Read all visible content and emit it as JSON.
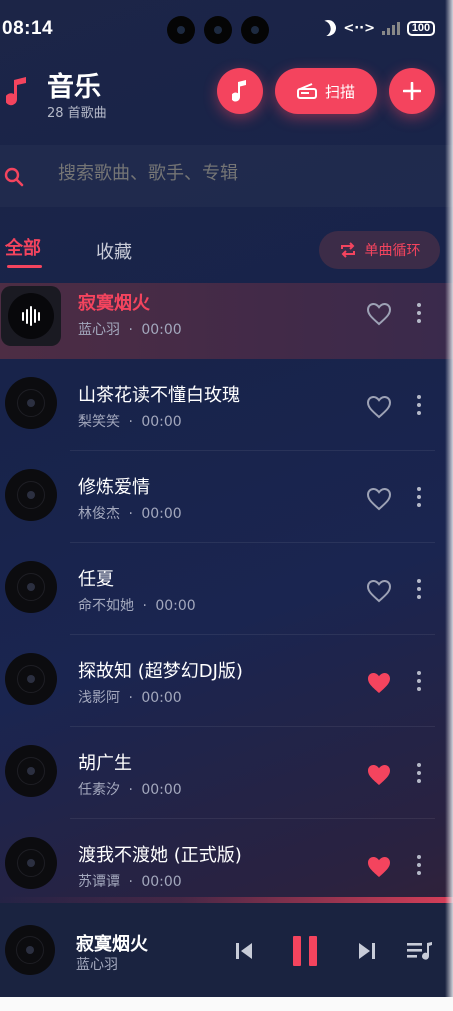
{
  "status_bar": {
    "time": "08:14",
    "battery": "100"
  },
  "header": {
    "title": "音乐",
    "subtitle": "28 首歌曲",
    "scan_label": "扫描",
    "icons": [
      "music-note-icon",
      "radio-scan-icon",
      "plus-icon"
    ]
  },
  "search": {
    "placeholder": "搜索歌曲、歌手、专辑"
  },
  "tabs": [
    {
      "label": "全部",
      "active": true
    },
    {
      "label": "收藏",
      "active": false
    }
  ],
  "play_mode": {
    "label": "单曲循环"
  },
  "songs": [
    {
      "title": "寂寞烟火",
      "artist": "蓝心羽",
      "duration": "00:00",
      "favorite": false,
      "playing": true
    },
    {
      "title": "山茶花读不懂白玫瑰",
      "artist": "梨笑笑",
      "duration": "00:00",
      "favorite": false,
      "playing": false
    },
    {
      "title": "修炼爱情",
      "artist": "林俊杰",
      "duration": "00:00",
      "favorite": false,
      "playing": false
    },
    {
      "title": "任夏",
      "artist": "命不如她",
      "duration": "00:00",
      "favorite": false,
      "playing": false
    },
    {
      "title": "探故知 (超梦幻DJ版)",
      "artist": "浅影阿",
      "duration": "00:00",
      "favorite": true,
      "playing": false
    },
    {
      "title": "胡广生",
      "artist": "任素汐",
      "duration": "00:00",
      "favorite": true,
      "playing": false
    },
    {
      "title": "渡我不渡她 (正式版)",
      "artist": "苏谭谭",
      "duration": "00:00",
      "favorite": true,
      "playing": false
    }
  ],
  "separator": "·",
  "now_playing": {
    "title": "寂寞烟火",
    "artist": "蓝心羽"
  },
  "colors": {
    "accent": "#f4445e",
    "background": "#1c2547",
    "text_secondary": "#a3a8bd"
  }
}
